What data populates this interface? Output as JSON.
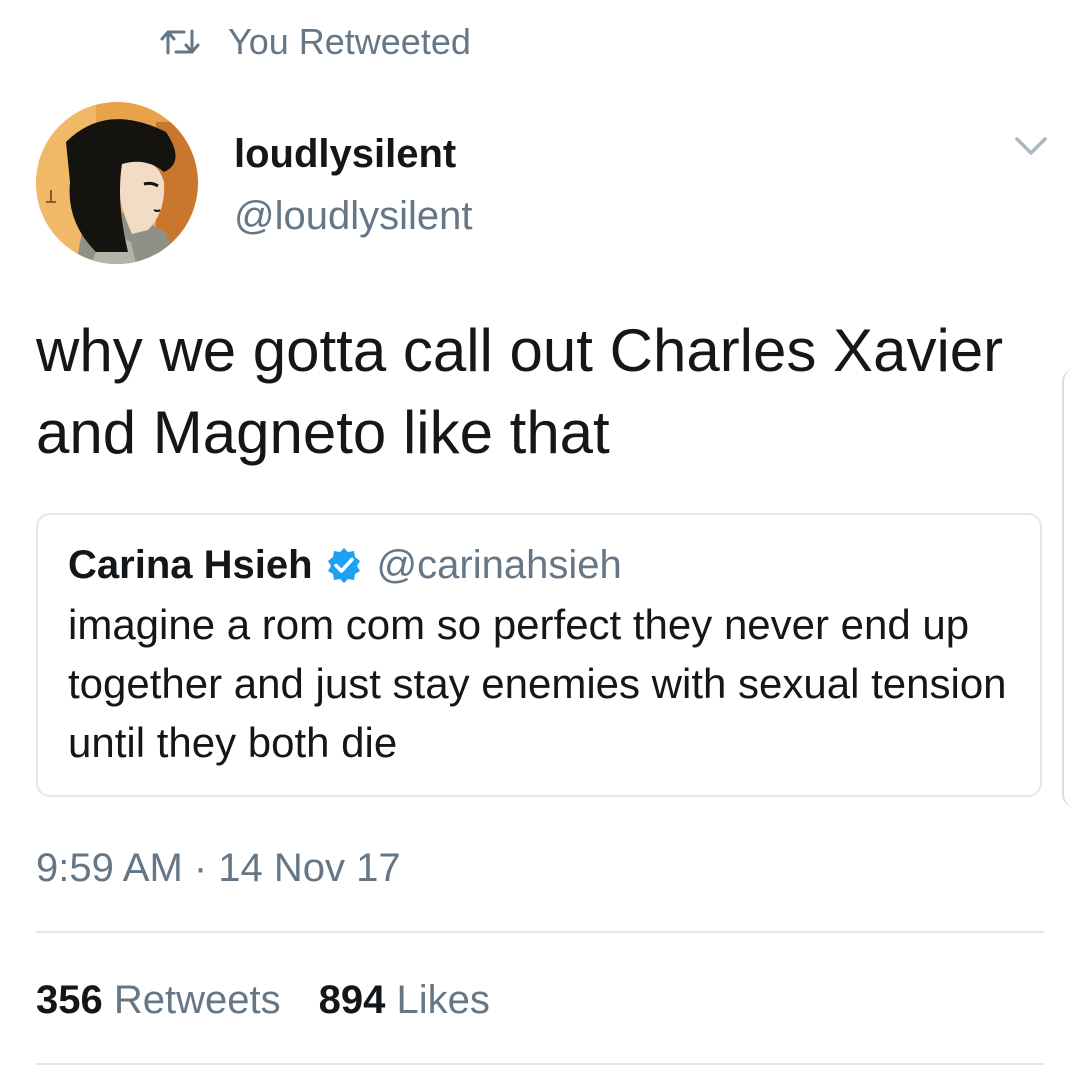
{
  "retweet_context": {
    "icon": "retweet-icon",
    "label": "You Retweeted"
  },
  "author": {
    "display_name": "loudlysilent",
    "handle": "@loudlysilent"
  },
  "tweet": {
    "text": "why we gotta call out Charles Xavier and Magneto like that"
  },
  "quoted_tweet": {
    "display_name": "Carina Hsieh",
    "verified_icon": "verified-badge-icon",
    "handle": "@carinahsieh",
    "text": "imagine a rom com so perfect they never end up together and just stay enemies with sexual tension until they both die"
  },
  "timestamp": "9:59 AM · 14 Nov 17",
  "stats": {
    "retweets_count": "356",
    "retweets_label": "Retweets",
    "likes_count": "894",
    "likes_label": "Likes"
  },
  "colors": {
    "text": "#14171a",
    "secondary": "#657786",
    "border": "#e1e8ed",
    "verified": "#1da1f2"
  }
}
